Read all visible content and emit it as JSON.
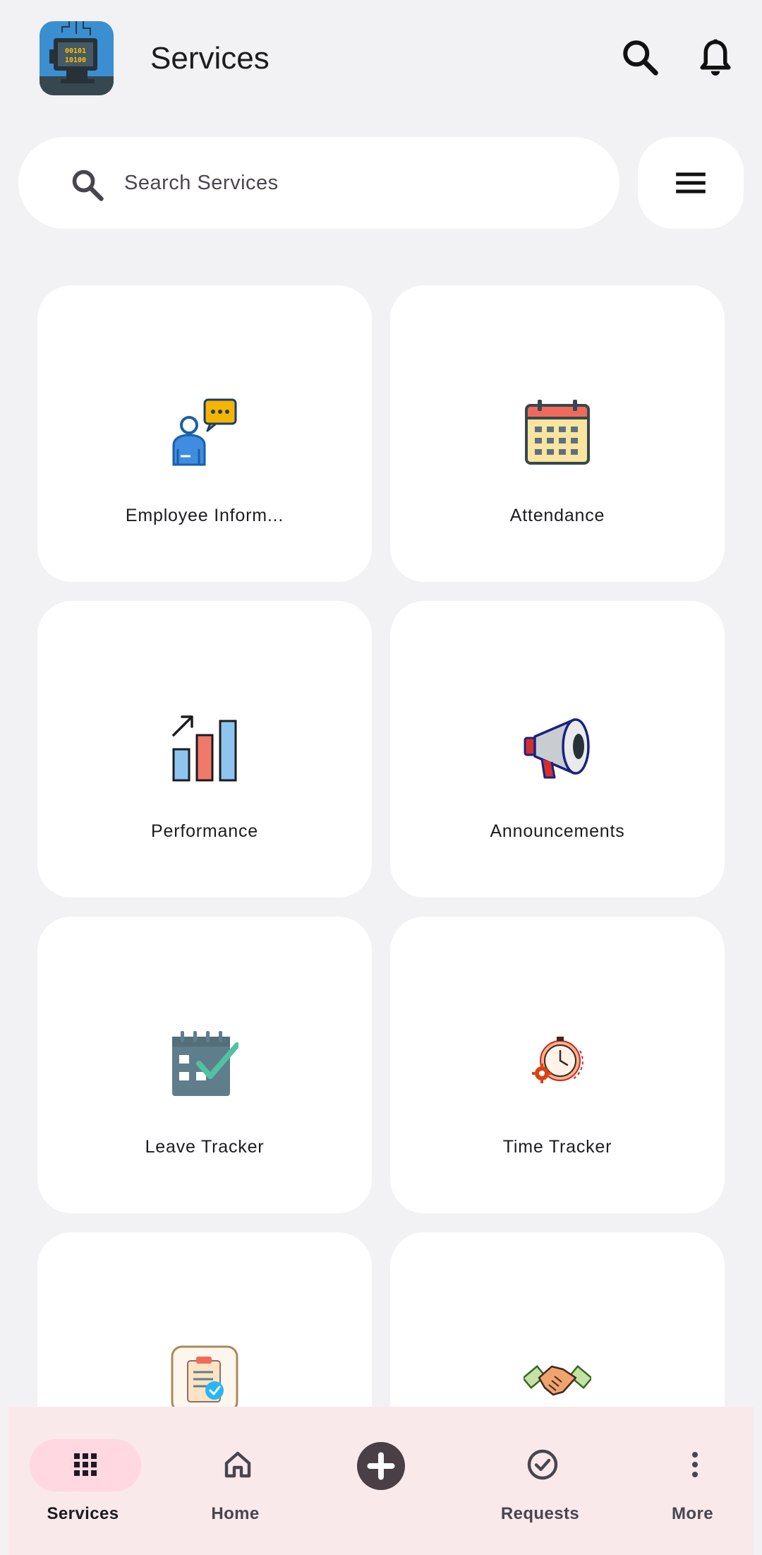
{
  "header": {
    "title": "Services",
    "logo_text_top": "00101",
    "logo_text_bottom": "10100"
  },
  "search": {
    "placeholder": "Search Services"
  },
  "services": [
    {
      "label": "Employee Inform...",
      "icon": "employee-chat-icon"
    },
    {
      "label": "Attendance",
      "icon": "calendar-icon"
    },
    {
      "label": "Performance",
      "icon": "bar-chart-icon"
    },
    {
      "label": "Announcements",
      "icon": "megaphone-icon"
    },
    {
      "label": "Leave Tracker",
      "icon": "calendar-check-icon"
    },
    {
      "label": "Time Tracker",
      "icon": "stopwatch-gear-icon"
    },
    {
      "label": "",
      "icon": "clipboard-check-icon"
    },
    {
      "label": "",
      "icon": "handshake-icon"
    }
  ],
  "nav": {
    "items": [
      {
        "label": "Services",
        "icon": "grid-icon",
        "active": true
      },
      {
        "label": "Home",
        "icon": "home-icon",
        "active": false
      },
      {
        "label": "",
        "icon": "add-circle-icon",
        "active": false
      },
      {
        "label": "Requests",
        "icon": "check-circle-icon",
        "active": false
      },
      {
        "label": "More",
        "icon": "more-vertical-icon",
        "active": false
      }
    ]
  },
  "colors": {
    "background": "#f2f1f3",
    "card": "#ffffff",
    "nav_background": "#f9e9eb",
    "nav_active_pill": "#ffd8e1",
    "nav_add": "#4a3f44"
  }
}
